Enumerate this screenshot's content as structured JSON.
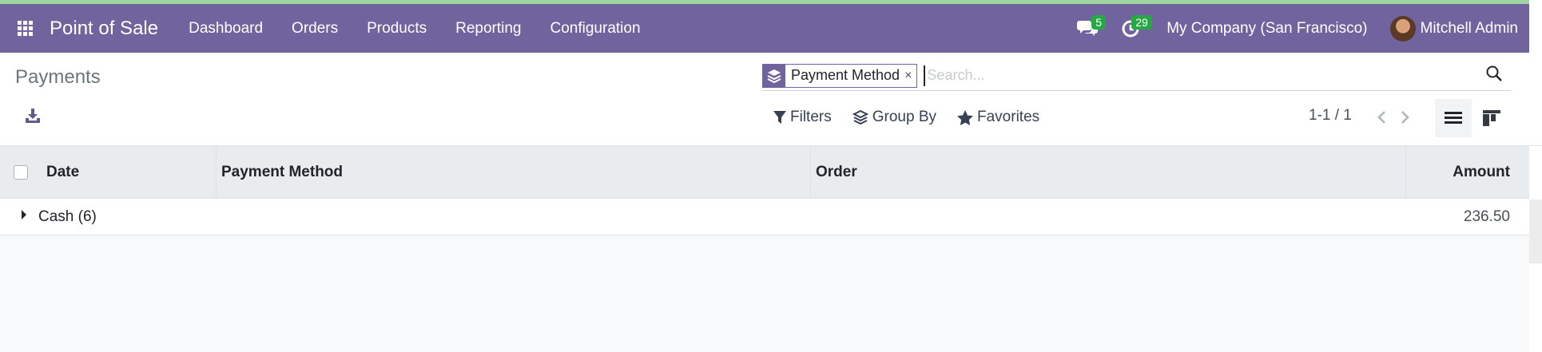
{
  "navbar": {
    "brand": "Point of Sale",
    "menu": [
      "Dashboard",
      "Orders",
      "Products",
      "Reporting",
      "Configuration"
    ],
    "messages_count": "5",
    "activities_count": "29",
    "company": "My Company (San Francisco)",
    "user": "Mitchell Admin",
    "accent_color": "#71639e"
  },
  "control": {
    "title": "Payments",
    "facet_label": "Payment Method",
    "facet_remove": "×",
    "search_placeholder": "Search...",
    "filters_label": "Filters",
    "group_by_label": "Group By",
    "favorites_label": "Favorites",
    "pager": "1-1 / 1"
  },
  "table": {
    "columns": [
      "Date",
      "Payment Method",
      "Order",
      "Amount"
    ],
    "groups": [
      {
        "label": "Cash (6)",
        "amount": "236.50"
      }
    ]
  }
}
